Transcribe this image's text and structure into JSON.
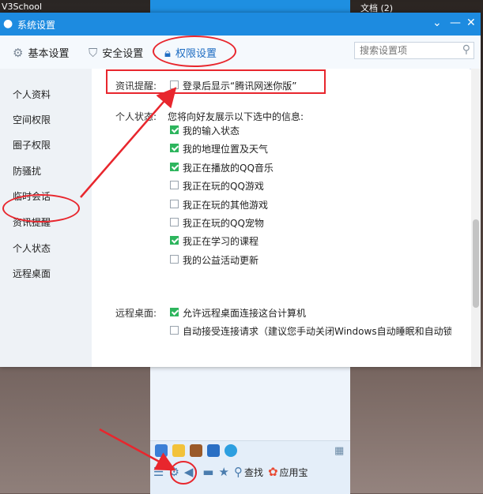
{
  "desktop": {
    "left_label": "V3School",
    "right_label": "文档 (2)"
  },
  "window": {
    "title": "系统设置",
    "logo_icon": "qq-penguin-icon",
    "menu_icon": "chevron-down-icon",
    "min_icon": "minimize-icon",
    "close_icon": "close-icon"
  },
  "tabs": [
    {
      "label": "基本设置",
      "icon": "gear-icon"
    },
    {
      "label": "安全设置",
      "icon": "shield-icon"
    },
    {
      "label": "权限设置",
      "icon": "lock-icon",
      "active": true
    }
  ],
  "search": {
    "placeholder": "搜索设置项",
    "icon": "search-icon"
  },
  "sidebar": {
    "items": [
      {
        "label": "个人资料"
      },
      {
        "label": "空间权限"
      },
      {
        "label": "圈子权限"
      },
      {
        "label": "防骚扰"
      },
      {
        "label": "临时会话"
      },
      {
        "label": "资讯提醒",
        "selected": true
      },
      {
        "label": "个人状态"
      },
      {
        "label": "远程桌面"
      }
    ]
  },
  "news": {
    "label": "资讯提醒:",
    "option": {
      "text": "登录后显示“腾讯网迷你版”",
      "checked": false
    }
  },
  "status": {
    "label": "个人状态:",
    "intro": "您将向好友展示以下选中的信息:",
    "options": [
      {
        "text": "我的输入状态",
        "checked": true
      },
      {
        "text": "我的地理位置及天气",
        "checked": true
      },
      {
        "text": "我正在播放的QQ音乐",
        "checked": true
      },
      {
        "text": "我正在玩的QQ游戏",
        "checked": false
      },
      {
        "text": "我正在玩的其他游戏",
        "checked": false
      },
      {
        "text": "我正在玩的QQ宠物",
        "checked": false
      },
      {
        "text": "我正在学习的课程",
        "checked": true
      },
      {
        "text": "我的公益活动更新",
        "checked": false
      }
    ]
  },
  "remote": {
    "label": "远程桌面:",
    "options": [
      {
        "text": "允许远程桌面连接这台计算机",
        "checked": true
      },
      {
        "text": "自动接受连接请求（建议您手动关闭Windows自动睡眠和自动锁屏功能）",
        "checked": false
      }
    ]
  },
  "qq_panel": {
    "tray_apps": [
      "star-app-icon",
      "note-app-icon",
      "book-app-icon",
      "edu-app-icon",
      "browser-app-icon"
    ],
    "grid_icon": "app-grid-icon",
    "tools": {
      "menu_icon": "menu-icon",
      "settings_icon": "gear-icon",
      "sound_icon": "speaker-icon",
      "folder_icon": "folder-icon",
      "favorite_icon": "star-icon",
      "find_label": "查找",
      "app_store_label": "应用宝"
    }
  },
  "colors": {
    "titlebar": "#1d8be0",
    "accent": "#1d6cc2",
    "annotation_red": "#e8262d",
    "checkbox_on": "#2db55d"
  }
}
